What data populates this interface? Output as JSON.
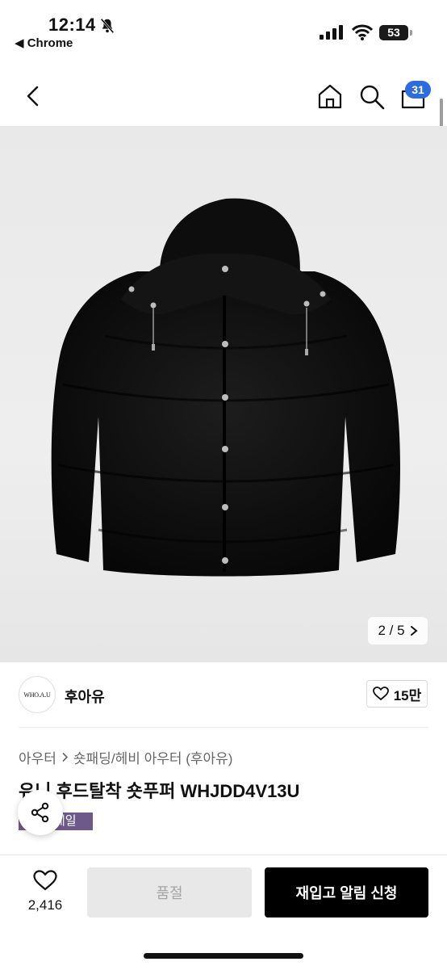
{
  "status_bar": {
    "time": "12:14",
    "back_app": "◀ Chrome",
    "battery": "53",
    "icons": [
      "bell-muted-icon",
      "signal-icon",
      "wifi-icon",
      "battery-icon"
    ]
  },
  "nav": {
    "icons": [
      "back-icon",
      "home-icon",
      "search-icon",
      "cart-icon"
    ],
    "cart_count": "31"
  },
  "gallery": {
    "image": "black-hooded-puffer-jacket",
    "pager_text": "2 / 5",
    "pager_icon": "chevron-right-icon"
  },
  "brand": {
    "logo_text": "WHO.A.U",
    "name": "후아유",
    "likes": "15만"
  },
  "product": {
    "breadcrumb": [
      "아우터",
      "숏패딩/헤비 아우터 (후아유)"
    ],
    "title": "유니 후드탈착 숏푸퍼 WHJDD4V13U",
    "badge": "세일"
  },
  "bottom_bar": {
    "wish_count": "2,416",
    "soldout_label": "품절",
    "restock_label": "재입고 알림 신청"
  },
  "colors": {
    "accent_badge": "#2d6cdf",
    "sale_badge": "#6e5a8a",
    "primary_button": "#000000",
    "disabled_button": "#e8e8e8"
  }
}
